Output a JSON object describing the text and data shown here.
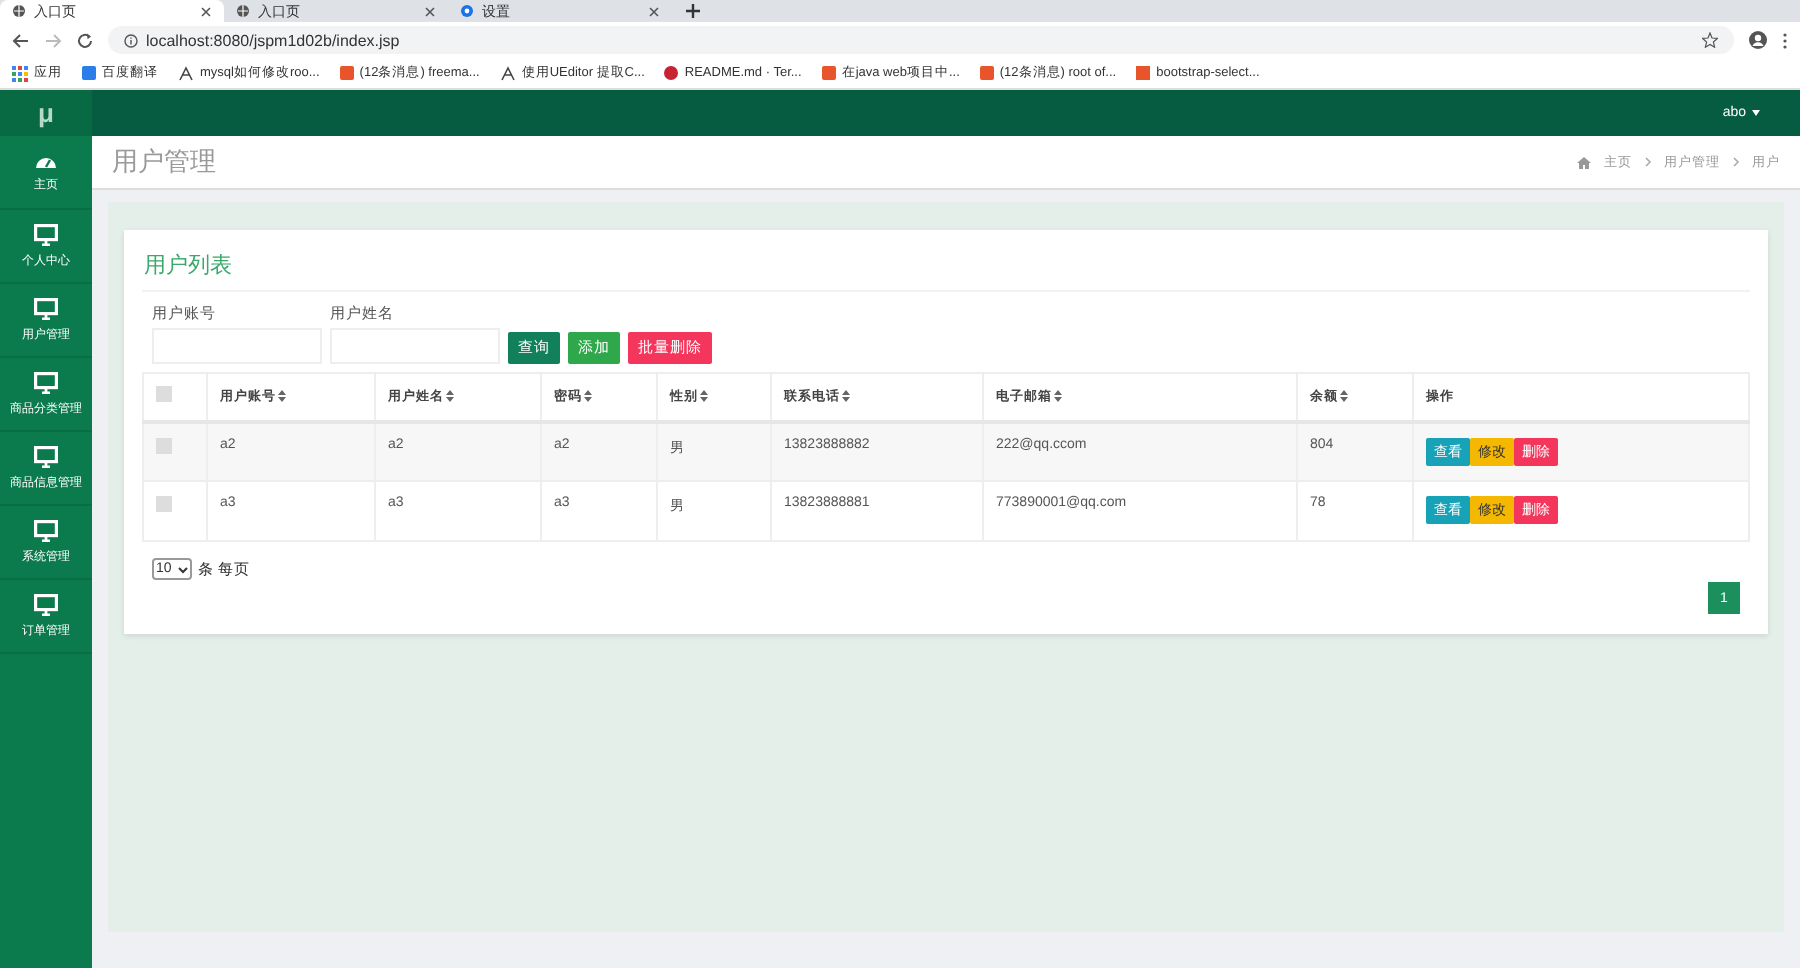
{
  "browser": {
    "tabs": [
      {
        "title": "入口页",
        "selected": true,
        "kind": "page"
      },
      {
        "title": "入口页",
        "selected": false,
        "kind": "page"
      },
      {
        "title": "设置",
        "selected": false,
        "kind": "settings"
      }
    ],
    "address": "localhost:8080/jspm1d02b/index.jsp",
    "bookmarks": [
      {
        "label": "应用",
        "kind": "apps"
      },
      {
        "label": "百度翻译",
        "kind": "blue"
      },
      {
        "label": "mysql如何修改roo...",
        "kind": "plain"
      },
      {
        "label": "(12条消息) freema...",
        "kind": "red"
      },
      {
        "label": "使用UEditor 提取C...",
        "kind": "plain"
      },
      {
        "label": "README.md · Ter...",
        "kind": "circle"
      },
      {
        "label": "在java web项目中...",
        "kind": "red"
      },
      {
        "label": "(12条消息) root of...",
        "kind": "red"
      },
      {
        "label": "bootstrap-select...",
        "kind": "square"
      }
    ]
  },
  "sidebar": {
    "logo": "μ",
    "items": [
      {
        "label": "主页",
        "kind": "dashboard"
      },
      {
        "label": "个人中心",
        "kind": "monitor"
      },
      {
        "label": "用户管理",
        "kind": "monitor"
      },
      {
        "label": "商品分类管理",
        "kind": "monitor"
      },
      {
        "label": "商品信息管理",
        "kind": "monitor"
      },
      {
        "label": "系统管理",
        "kind": "monitor"
      },
      {
        "label": "订单管理",
        "kind": "monitor"
      }
    ]
  },
  "topbar": {
    "user": "abo"
  },
  "header": {
    "title": "用户管理",
    "breadcrumb": [
      "主页",
      "用户管理",
      "用户"
    ]
  },
  "card": {
    "title": "用户列表",
    "filters": [
      {
        "label": "用户账号"
      },
      {
        "label": "用户姓名"
      }
    ],
    "buttons": [
      {
        "label": "查询",
        "kind": "query"
      },
      {
        "label": "添加",
        "kind": "add"
      },
      {
        "label": "批量删除",
        "kind": "delete"
      }
    ],
    "table": {
      "select_all_checked": false,
      "columns": [
        "用户账号",
        "用户姓名",
        "密码",
        "性别",
        "联系电话",
        "电子邮箱",
        "余额",
        "操作"
      ],
      "rows": [
        {
          "checked": false,
          "cells": [
            "a2",
            "a2",
            "a2",
            "男",
            "13823888882",
            "222@qq.ccom",
            "804"
          ],
          "actions": [
            {
              "label": "查看",
              "kind": "view"
            },
            {
              "label": "修改",
              "kind": "edit"
            },
            {
              "label": "删除",
              "kind": "delete"
            }
          ]
        },
        {
          "checked": false,
          "cells": [
            "a3",
            "a3",
            "a3",
            "男",
            "13823888881",
            "773890001@qq.com",
            "78"
          ],
          "actions": [
            {
              "label": "查看",
              "kind": "view"
            },
            {
              "label": "修改",
              "kind": "edit"
            },
            {
              "label": "删除",
              "kind": "delete"
            }
          ]
        }
      ]
    },
    "page_size": "10",
    "page_size_label": "条 每页",
    "pages": [
      {
        "label": "1",
        "selected": true
      }
    ]
  }
}
